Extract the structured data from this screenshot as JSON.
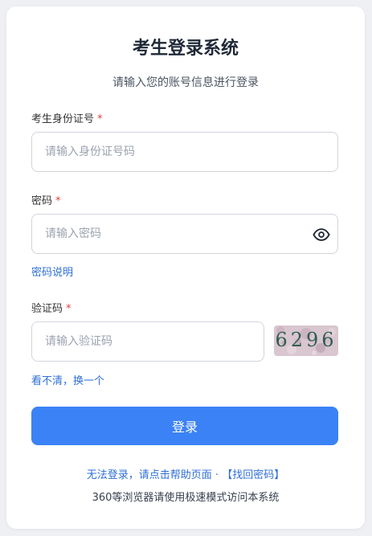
{
  "header": {
    "title": "考生登录系统",
    "subtitle": "请输入您的账号信息进行登录"
  },
  "form": {
    "id_label": "考生身份证号",
    "id_placeholder": "请输入身份证号码",
    "password_label": "密码",
    "password_placeholder": "请输入密码",
    "password_help_link": "密码说明",
    "captcha_label": "验证码",
    "captcha_placeholder": "请输入验证码",
    "captcha_image_text": "6296",
    "captcha_refresh_link": "看不清，换一个",
    "required_mark": "*",
    "login_button": "登录"
  },
  "footer": {
    "help_text": "无法登录，请点击帮助页面",
    "separator": " · ",
    "find_password_link": "【找回密码】",
    "browser_note": "360等浏览器请使用极速模式访问本系统"
  },
  "icons": {
    "password_toggle": "eye-icon"
  },
  "colors": {
    "primary": "#3b82f6",
    "link": "#2f6fd6",
    "required": "#e53e3e"
  }
}
